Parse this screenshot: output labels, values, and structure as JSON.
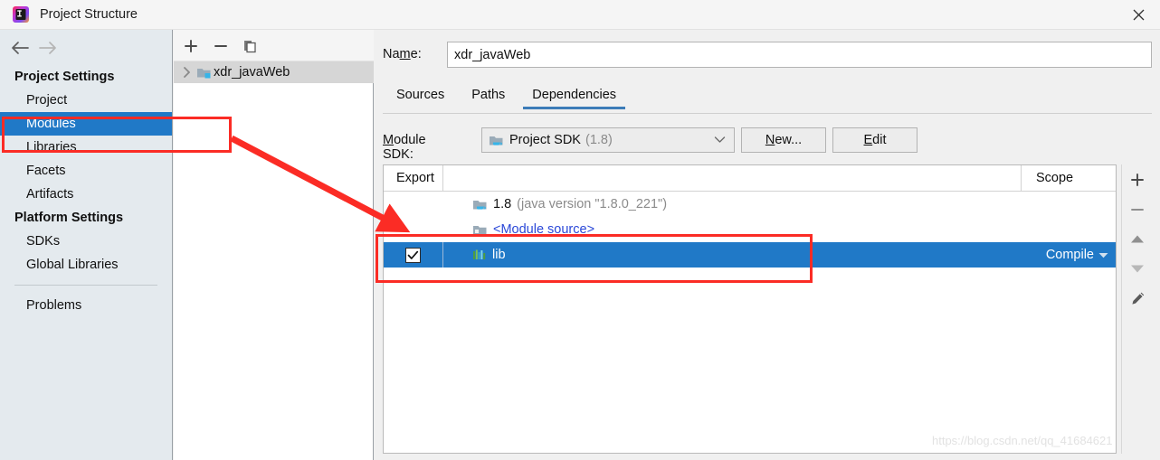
{
  "window": {
    "title": "Project Structure",
    "app_icon": "intellij-idea-icon",
    "close_icon": "close-icon"
  },
  "sidebar": {
    "nav": {
      "back_icon": "arrow-left-icon",
      "forward_icon": "arrow-right-icon"
    },
    "groups": [
      {
        "label": "Project Settings",
        "items": [
          {
            "label": "Project",
            "selected": false
          },
          {
            "label": "Modules",
            "selected": true
          },
          {
            "label": "Libraries",
            "selected": false
          },
          {
            "label": "Facets",
            "selected": false
          },
          {
            "label": "Artifacts",
            "selected": false
          }
        ]
      },
      {
        "label": "Platform Settings",
        "items": [
          {
            "label": "SDKs",
            "selected": false
          },
          {
            "label": "Global Libraries",
            "selected": false
          }
        ]
      }
    ],
    "footer_items": [
      {
        "label": "Problems",
        "selected": false
      }
    ]
  },
  "tree_panel": {
    "toolbar": [
      {
        "name": "add-module-button",
        "icon": "plus-icon"
      },
      {
        "name": "remove-module-button",
        "icon": "minus-icon"
      },
      {
        "name": "copy-module-button",
        "icon": "copy-icon"
      }
    ],
    "rows": [
      {
        "label": "xdr_javaWeb",
        "chevron_icon": "chevron-right-icon",
        "folder_icon": "module-folder-icon",
        "selected": true
      }
    ]
  },
  "content": {
    "name_field": {
      "label": "Na",
      "label_mnemonic": "m",
      "label_rest": "e:",
      "value": "xdr_javaWeb",
      "placeholder": "Module name"
    },
    "tabs": [
      {
        "label": "Sources",
        "active": false
      },
      {
        "label": "Paths",
        "active": false
      },
      {
        "label": "Dependencies",
        "active": true
      }
    ],
    "module_sdk": {
      "label_mnemonic": "M",
      "label_rest": "odule SDK:",
      "icon": "java-sdk-icon",
      "value": "Project SDK",
      "version": "(1.8)",
      "dropdown_icon": "chevron-down-icon",
      "new_button": {
        "mnemonic": "N",
        "rest": "ew..."
      },
      "edit_button": {
        "mnemonic": "E",
        "rest": "dit"
      }
    },
    "table": {
      "headers": {
        "export": "Export",
        "middle": "",
        "scope": "Scope"
      },
      "rows": [
        {
          "export_checked": null,
          "icon": "java-sdk-icon",
          "name": "1.8",
          "name_suffix": "(java version \"1.8.0_221\")",
          "scope": "",
          "selected": false,
          "style": "sdk"
        },
        {
          "export_checked": null,
          "icon": "module-source-icon",
          "name": "<Module source>",
          "name_suffix": "",
          "scope": "",
          "selected": false,
          "style": "source"
        },
        {
          "export_checked": true,
          "icon": "library-icon",
          "name": "lib",
          "name_suffix": "",
          "scope": "Compile",
          "scope_dropdown_icon": "caret-down-icon",
          "selected": true,
          "style": "library"
        }
      ]
    },
    "side_toolbar": [
      {
        "name": "add-dependency-button",
        "icon": "plus-icon"
      },
      {
        "name": "remove-dependency-button",
        "icon": "minus-icon"
      },
      {
        "name": "move-up-button",
        "icon": "arrow-up-icon"
      },
      {
        "name": "move-down-button",
        "icon": "arrow-down-icon"
      },
      {
        "name": "edit-dependency-button",
        "icon": "pencil-icon"
      }
    ]
  },
  "watermark": "https://blog.csdn.net/qq_41684621",
  "annotations": {
    "modules_box": "red-highlight-box",
    "lib_box": "red-highlight-box",
    "arrow": "red-arrow"
  },
  "colors": {
    "selection_blue": "#2079c7",
    "tab_underline": "#3c7cb8",
    "annotation_red": "#fb2c25",
    "sidebar_bg": "#e4eaee",
    "link_blue": "#2b48d8"
  }
}
